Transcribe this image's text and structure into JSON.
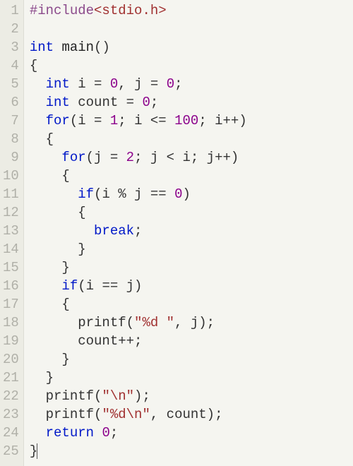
{
  "line_numbers": [
    "1",
    "2",
    "3",
    "4",
    "5",
    "6",
    "7",
    "8",
    "9",
    "10",
    "11",
    "12",
    "13",
    "14",
    "15",
    "16",
    "17",
    "18",
    "19",
    "20",
    "21",
    "22",
    "23",
    "24",
    "25"
  ],
  "lines": [
    [
      {
        "t": "#include",
        "c": "kw-pp"
      },
      {
        "t": "<stdio.h>",
        "c": "str"
      }
    ],
    [],
    [
      {
        "t": "int",
        "c": "kw-type"
      },
      {
        "t": " ",
        "c": "punct"
      },
      {
        "t": "main",
        "c": "ident"
      },
      {
        "t": "()",
        "c": "punct"
      }
    ],
    [
      {
        "t": "{",
        "c": "punct"
      }
    ],
    [
      {
        "t": "  ",
        "c": "punct"
      },
      {
        "t": "int",
        "c": "kw-type"
      },
      {
        "t": " i = ",
        "c": "punct"
      },
      {
        "t": "0",
        "c": "num"
      },
      {
        "t": ", j = ",
        "c": "punct"
      },
      {
        "t": "0",
        "c": "num"
      },
      {
        "t": ";",
        "c": "punct"
      }
    ],
    [
      {
        "t": "  ",
        "c": "punct"
      },
      {
        "t": "int",
        "c": "kw-type"
      },
      {
        "t": " count = ",
        "c": "punct"
      },
      {
        "t": "0",
        "c": "num"
      },
      {
        "t": ";",
        "c": "punct"
      }
    ],
    [
      {
        "t": "  ",
        "c": "punct"
      },
      {
        "t": "for",
        "c": "kw-ctrl"
      },
      {
        "t": "(i = ",
        "c": "punct"
      },
      {
        "t": "1",
        "c": "num"
      },
      {
        "t": "; i <= ",
        "c": "punct"
      },
      {
        "t": "100",
        "c": "num"
      },
      {
        "t": "; i++)",
        "c": "punct"
      }
    ],
    [
      {
        "t": "  {",
        "c": "punct"
      }
    ],
    [
      {
        "t": "    ",
        "c": "punct"
      },
      {
        "t": "for",
        "c": "kw-ctrl"
      },
      {
        "t": "(j = ",
        "c": "punct"
      },
      {
        "t": "2",
        "c": "num"
      },
      {
        "t": "; j < i; j++)",
        "c": "punct"
      }
    ],
    [
      {
        "t": "    {",
        "c": "punct"
      }
    ],
    [
      {
        "t": "      ",
        "c": "punct"
      },
      {
        "t": "if",
        "c": "kw-ctrl"
      },
      {
        "t": "(i % j == ",
        "c": "punct"
      },
      {
        "t": "0",
        "c": "num"
      },
      {
        "t": ")",
        "c": "punct"
      }
    ],
    [
      {
        "t": "      {",
        "c": "punct"
      }
    ],
    [
      {
        "t": "        ",
        "c": "punct"
      },
      {
        "t": "break",
        "c": "kw-ctrl"
      },
      {
        "t": ";",
        "c": "punct"
      }
    ],
    [
      {
        "t": "      }",
        "c": "punct"
      }
    ],
    [
      {
        "t": "    }",
        "c": "punct"
      }
    ],
    [
      {
        "t": "    ",
        "c": "punct"
      },
      {
        "t": "if",
        "c": "kw-ctrl"
      },
      {
        "t": "(i == j)",
        "c": "punct"
      }
    ],
    [
      {
        "t": "    {",
        "c": "punct"
      }
    ],
    [
      {
        "t": "      printf(",
        "c": "punct"
      },
      {
        "t": "\"%d \"",
        "c": "str"
      },
      {
        "t": ", j);",
        "c": "punct"
      }
    ],
    [
      {
        "t": "      count++;",
        "c": "punct"
      }
    ],
    [
      {
        "t": "    }",
        "c": "punct"
      }
    ],
    [
      {
        "t": "  }",
        "c": "punct"
      }
    ],
    [
      {
        "t": "  printf(",
        "c": "punct"
      },
      {
        "t": "\"\\n\"",
        "c": "str"
      },
      {
        "t": ");",
        "c": "punct"
      }
    ],
    [
      {
        "t": "  printf(",
        "c": "punct"
      },
      {
        "t": "\"%d\\n\"",
        "c": "str"
      },
      {
        "t": ", count);",
        "c": "punct"
      }
    ],
    [
      {
        "t": "  ",
        "c": "punct"
      },
      {
        "t": "return",
        "c": "kw-ctrl"
      },
      {
        "t": " ",
        "c": "punct"
      },
      {
        "t": "0",
        "c": "num"
      },
      {
        "t": ";",
        "c": "punct"
      }
    ],
    [
      {
        "t": "}",
        "c": "punct"
      }
    ]
  ],
  "cursor_line": 25
}
